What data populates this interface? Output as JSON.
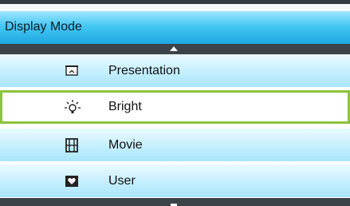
{
  "menu": {
    "title": "Display Mode",
    "items": [
      {
        "label": "Presentation",
        "icon": "presentation-icon"
      },
      {
        "label": "Bright",
        "icon": "bright-bulb-icon",
        "selected": true
      },
      {
        "label": "Movie",
        "icon": "film-icon"
      },
      {
        "label": "User",
        "icon": "user-heart-icon"
      }
    ]
  },
  "colors": {
    "header_top": "#9fe6ff",
    "header_bottom": "#1ea8e0",
    "item_bg": "#c8f0ff",
    "selected_border": "#8cc33f",
    "scroll_bar": "#3b4348"
  }
}
